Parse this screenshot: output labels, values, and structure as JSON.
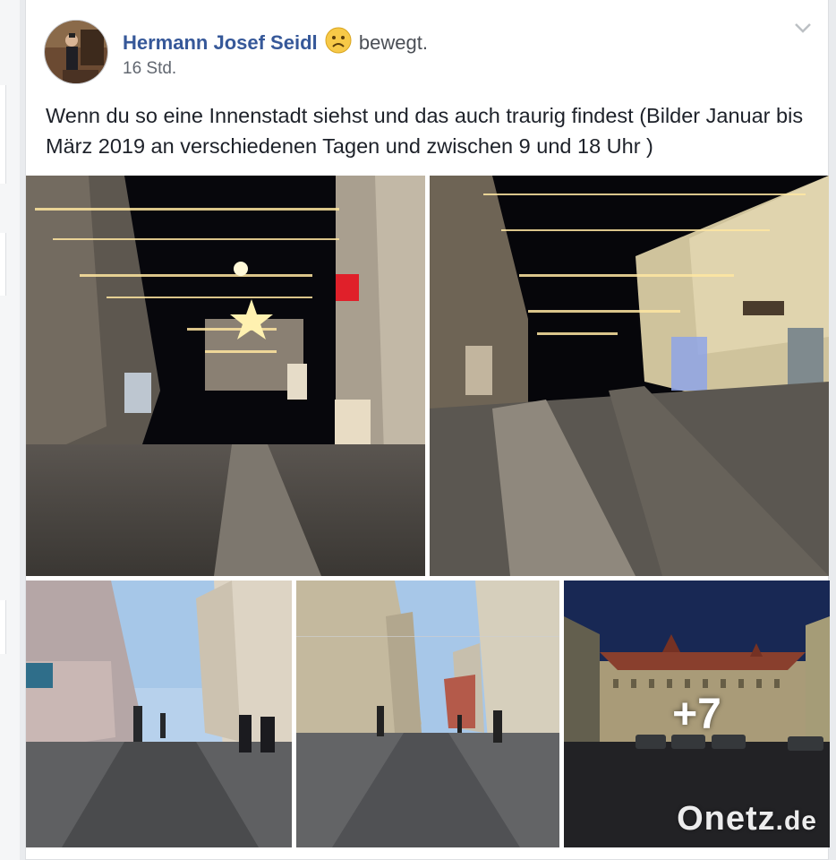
{
  "post": {
    "author": "Hermann Josef Seidl",
    "feeling_emoji": "sad-face-emoji",
    "feeling": "bewegt.",
    "timestamp": "16 Std.",
    "text": "Wenn du so eine Innenstadt siehst und das auch traurig findest (Bilder Januar bis März 2019 an verschiedenen Tagen und zwischen 9 und 18 Uhr )",
    "more_photos": "+7"
  },
  "watermark": {
    "brand": "Onetz",
    "suffix": ".de"
  },
  "colors": {
    "author_link": "#365899",
    "page_bg": "#e9ebee",
    "card_bg": "#ffffff",
    "night_sky": "#0a0a0f",
    "day_sky": "#a9c9e8"
  },
  "icons": [
    "chevron-down-icon",
    "sad-face-emoji",
    "avatar"
  ]
}
